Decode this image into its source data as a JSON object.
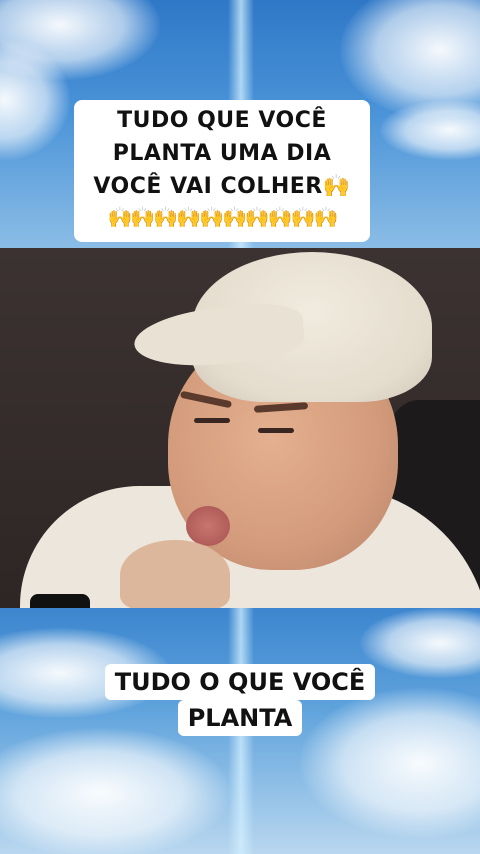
{
  "top_caption": {
    "line1": "TUDO QUE VOCÊ",
    "line2": "PLANTA UMA DIA",
    "line3": "VOCÊ VAI COLHER🙌",
    "line4": "🙌🙌🙌🙌🙌🙌🙌🙌🙌🙌"
  },
  "bottom_caption": {
    "line1": "TUDO O QUE VOCÊ",
    "line2": "PLANTA"
  },
  "colors": {
    "sky": "#3f87d0",
    "caption_bg": "#ffffff",
    "caption_text": "#111111",
    "cap_hat": "#e8e0d2"
  }
}
